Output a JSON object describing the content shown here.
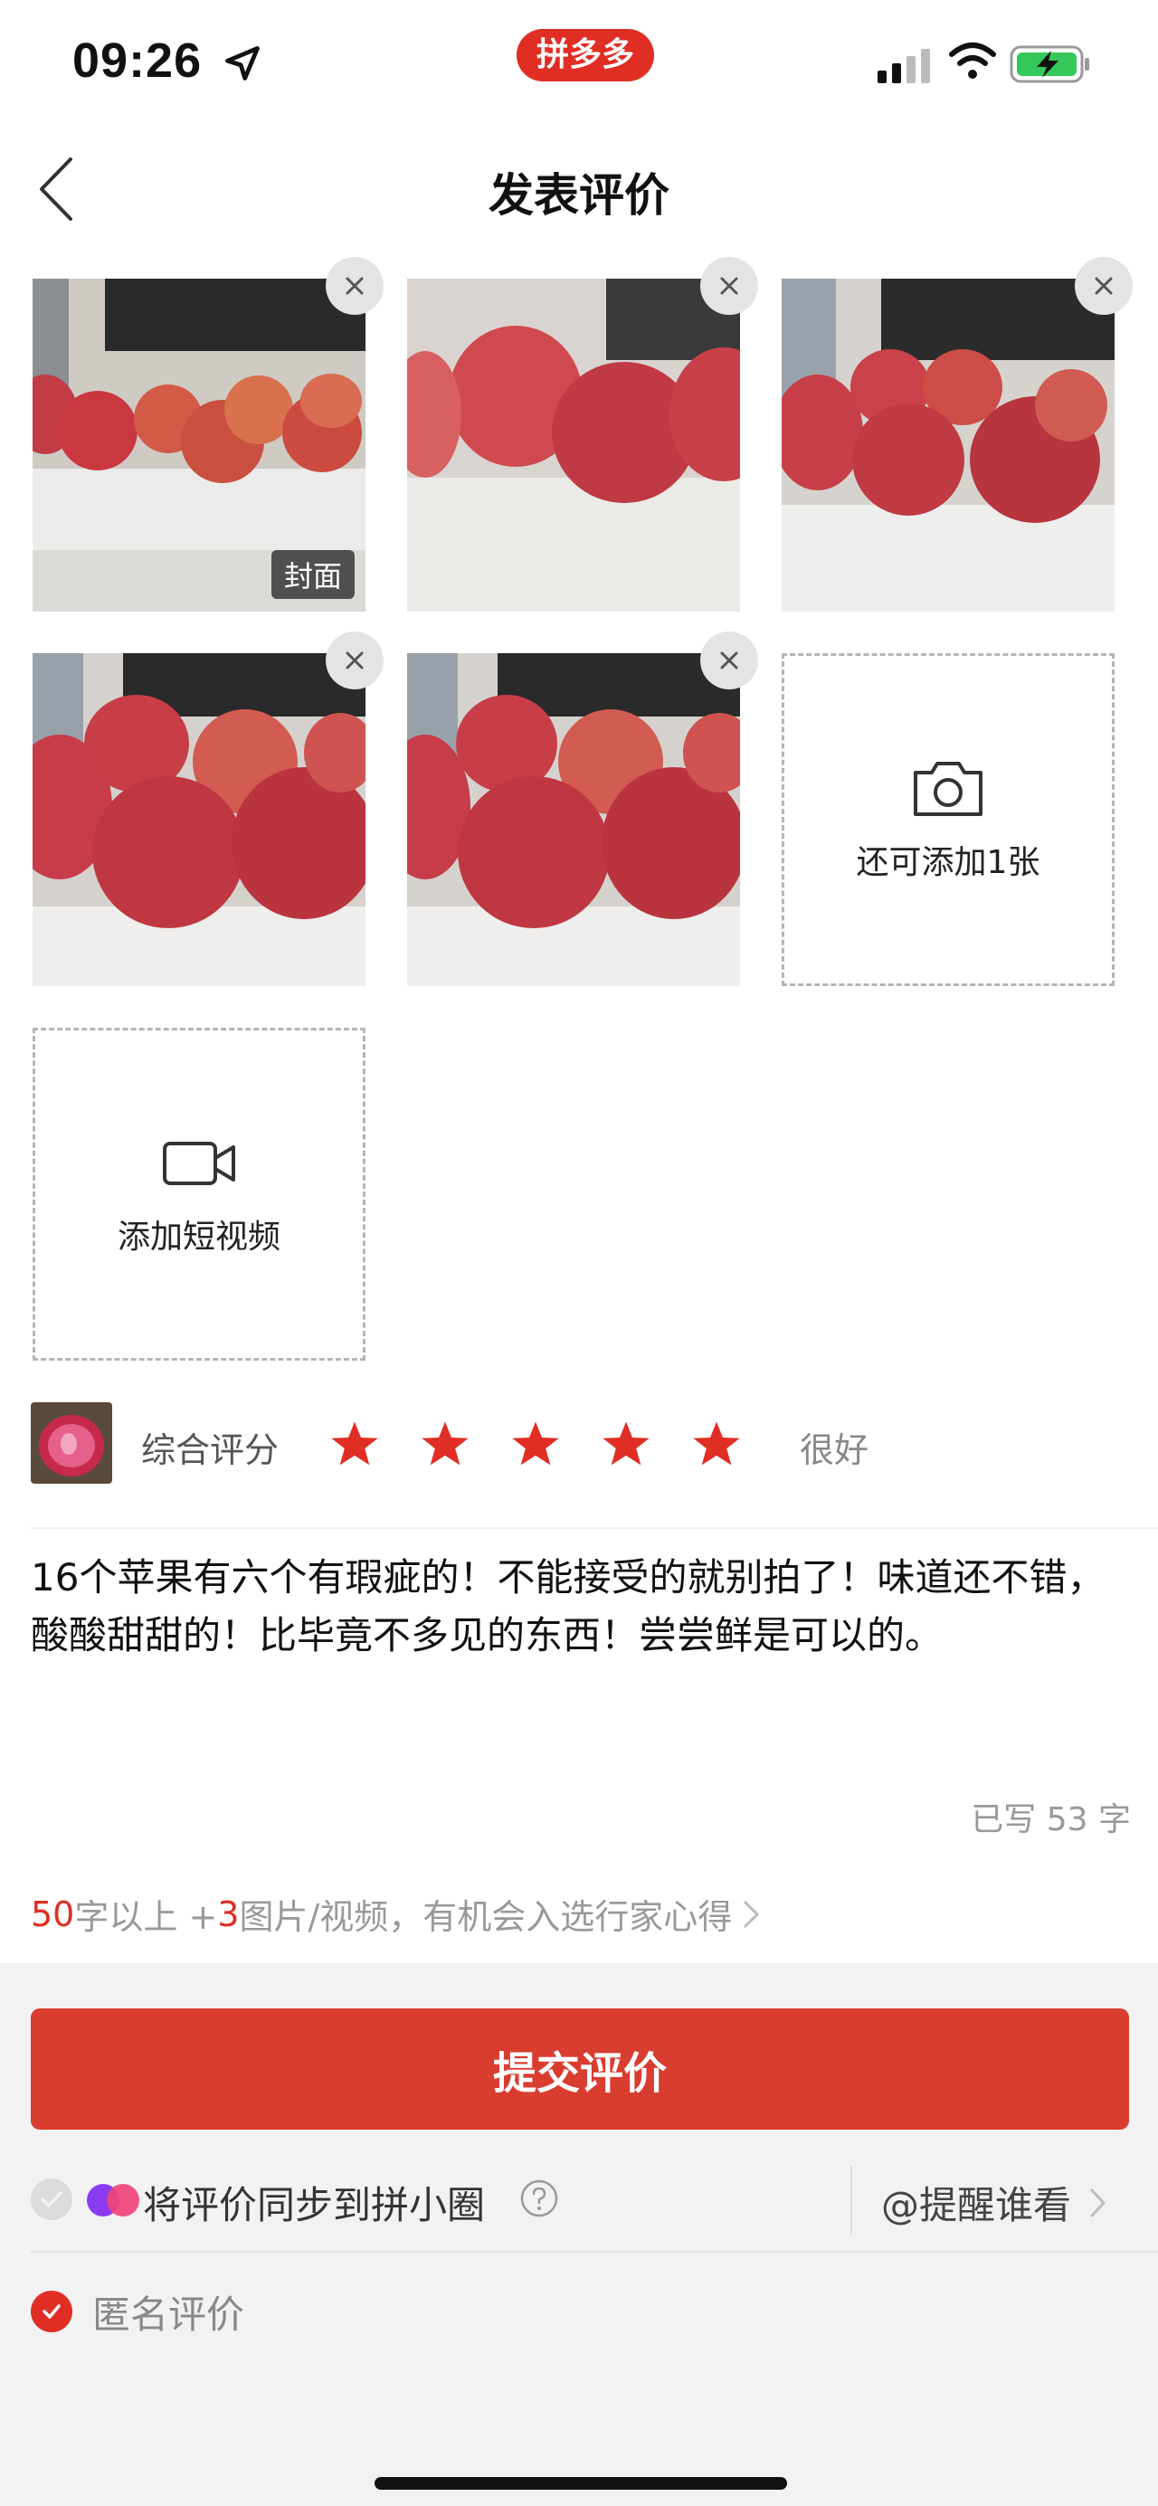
{
  "status_bar": {
    "time": "09:26",
    "app_badge": "拼多多",
    "icons": [
      "location-arrow-icon",
      "signal-icon",
      "wifi-icon",
      "battery-charging-icon"
    ]
  },
  "nav": {
    "title": "发表评价",
    "back_icon": "chevron-left-icon"
  },
  "photos": {
    "cover_label": "封面",
    "remove_icon": "close-icon",
    "add_photo_label": "还可添加1张",
    "add_photo_icon": "camera-icon",
    "add_video_label": "添加短视频",
    "add_video_icon": "video-camera-icon"
  },
  "rating": {
    "label": "综合评分",
    "stars_selected": 5,
    "stars_total": 5,
    "result_text": "很好",
    "star_color": "#e02e24"
  },
  "review": {
    "text": "16个苹果有六个有瑕疵的！不能接受的就别拍了！味道还不错，酸酸甜甜的！比毕竟不多见的东西！尝尝鲜是可以的。",
    "char_count": "已写 53 字"
  },
  "tip": {
    "num1": "50",
    "part1": "字以上 +",
    "num2": "3",
    "part2": "图片/视频，有机会入选行家心得"
  },
  "submit": {
    "label": "提交评价",
    "color": "#d83d30"
  },
  "sync": {
    "label": "将评价同步到拼小圈",
    "mention_label": "@提醒谁看"
  },
  "anonymous": {
    "label": "匿名评价",
    "checked": true
  }
}
